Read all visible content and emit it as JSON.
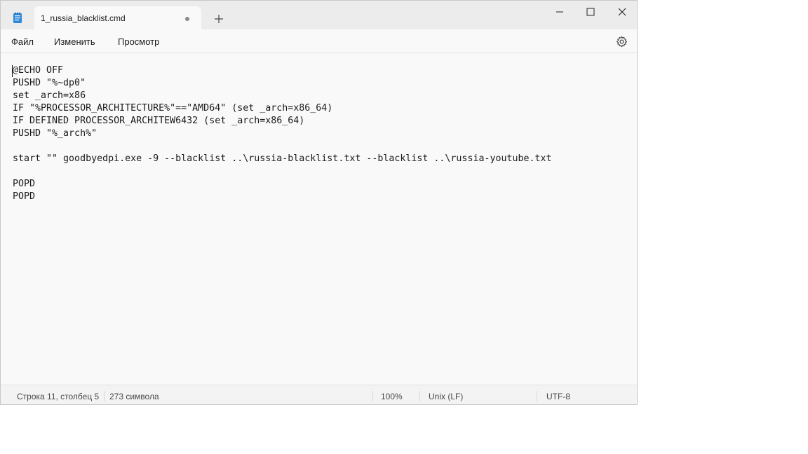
{
  "tab": {
    "title": "1_russia_blacklist.cmd",
    "unsaved_indicator_icon": "dot-icon",
    "new_tab_icon": "plus-icon"
  },
  "window_controls": {
    "minimize_icon": "minimize-icon",
    "maximize_icon": "maximize-icon",
    "close_icon": "close-icon"
  },
  "menu": {
    "file": "Файл",
    "edit": "Изменить",
    "view": "Просмотр",
    "settings_icon": "gear-icon"
  },
  "editor": {
    "lines": [
      "@ECHO OFF",
      "PUSHD \"%~dp0\"",
      "set _arch=x86",
      "IF \"%PROCESSOR_ARCHITECTURE%\"==\"AMD64\" (set _arch=x86_64)",
      "IF DEFINED PROCESSOR_ARCHITEW6432 (set _arch=x86_64)",
      "PUSHD \"%_arch%\"",
      "",
      "start \"\" goodbyedpi.exe -9 --blacklist ..\\russia-blacklist.txt --blacklist ..\\russia-youtube.txt",
      "",
      "POPD",
      "POPD"
    ]
  },
  "status": {
    "position": "Строка 11, столбец 5",
    "char_count": "273 символа",
    "zoom": "100%",
    "line_ending": "Unix (LF)",
    "encoding": "UTF-8"
  }
}
